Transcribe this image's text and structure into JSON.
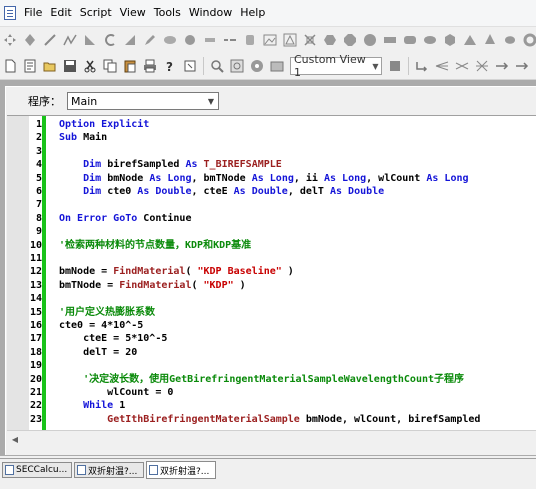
{
  "menu": [
    "File",
    "Edit",
    "Script",
    "View",
    "Tools",
    "Window",
    "Help"
  ],
  "toolbar2": {
    "custom_view": "Custom View 1"
  },
  "procedure": {
    "label": "程序：",
    "value": "Main"
  },
  "code_lines": [
    {
      "n": "1",
      "segs": [
        [
          "kw",
          "Option Explicit"
        ]
      ]
    },
    {
      "n": "2",
      "segs": [
        [
          "kw",
          "Sub "
        ],
        [
          "plain",
          "Main"
        ]
      ]
    },
    {
      "n": "3",
      "segs": []
    },
    {
      "n": "4",
      "segs": [
        [
          "plain",
          "    "
        ],
        [
          "kw",
          "Dim "
        ],
        [
          "plain",
          "birefSampled "
        ],
        [
          "kw",
          "As "
        ],
        [
          "fn",
          "T_BIREFSAMPLE"
        ]
      ]
    },
    {
      "n": "5",
      "segs": [
        [
          "plain",
          "    "
        ],
        [
          "kw",
          "Dim "
        ],
        [
          "plain",
          "bmNode "
        ],
        [
          "kw",
          "As Long"
        ],
        [
          "plain",
          ", bmTNode "
        ],
        [
          "kw",
          "As Long"
        ],
        [
          "plain",
          ", ii "
        ],
        [
          "kw",
          "As Long"
        ],
        [
          "plain",
          ", wlCount "
        ],
        [
          "kw",
          "As Long"
        ]
      ]
    },
    {
      "n": "6",
      "segs": [
        [
          "plain",
          "    "
        ],
        [
          "kw",
          "Dim "
        ],
        [
          "plain",
          "cte0 "
        ],
        [
          "kw",
          "As Double"
        ],
        [
          "plain",
          ", cteE "
        ],
        [
          "kw",
          "As Double"
        ],
        [
          "plain",
          ", delT "
        ],
        [
          "kw",
          "As Double"
        ]
      ]
    },
    {
      "n": "7",
      "segs": []
    },
    {
      "n": "8",
      "segs": [
        [
          "kw",
          "On Error GoTo "
        ],
        [
          "plain",
          "Continue"
        ]
      ]
    },
    {
      "n": "9",
      "segs": []
    },
    {
      "n": "10",
      "segs": [
        [
          "cm",
          "'检索两种材料的节点数量，KDP和KDP基准"
        ]
      ]
    },
    {
      "n": "11",
      "segs": []
    },
    {
      "n": "12",
      "segs": [
        [
          "plain",
          "bmNode = "
        ],
        [
          "fn",
          "FindMaterial"
        ],
        [
          "plain",
          "( "
        ],
        [
          "st",
          "\"KDP Baseline\""
        ],
        [
          "plain",
          " )"
        ]
      ]
    },
    {
      "n": "13",
      "segs": [
        [
          "plain",
          "bmTNode = "
        ],
        [
          "fn",
          "FindMaterial"
        ],
        [
          "plain",
          "( "
        ],
        [
          "st",
          "\"KDP\""
        ],
        [
          "plain",
          " )"
        ]
      ]
    },
    {
      "n": "14",
      "segs": []
    },
    {
      "n": "15",
      "segs": [
        [
          "cm",
          "'用户定义热膨胀系数"
        ]
      ]
    },
    {
      "n": "16",
      "segs": [
        [
          "plain",
          "cte0 = 4*10^-5"
        ]
      ]
    },
    {
      "n": "17",
      "segs": [
        [
          "plain",
          "    cteE = 5*10^-5"
        ]
      ]
    },
    {
      "n": "18",
      "segs": [
        [
          "plain",
          "    delT = 20"
        ]
      ]
    },
    {
      "n": "19",
      "segs": []
    },
    {
      "n": "20",
      "segs": [
        [
          "plain",
          "    "
        ],
        [
          "cm",
          "'决定波长数，使用GetBirefringentMaterialSampleWavelengthCount子程序"
        ]
      ]
    },
    {
      "n": "21",
      "segs": [
        [
          "plain",
          "        wlCount = 0"
        ]
      ]
    },
    {
      "n": "22",
      "segs": [
        [
          "plain",
          "    "
        ],
        [
          "kw",
          "While "
        ],
        [
          "plain",
          "1"
        ]
      ]
    },
    {
      "n": "23",
      "segs": [
        [
          "plain",
          "        "
        ],
        [
          "fn",
          "GetIthBirefringentMaterialSample"
        ],
        [
          "plain",
          " bmNode, wlCount, birefSampled"
        ]
      ]
    }
  ],
  "tabs": [
    "SECCalcu...",
    "双折射温?...",
    "双折射温?..."
  ]
}
